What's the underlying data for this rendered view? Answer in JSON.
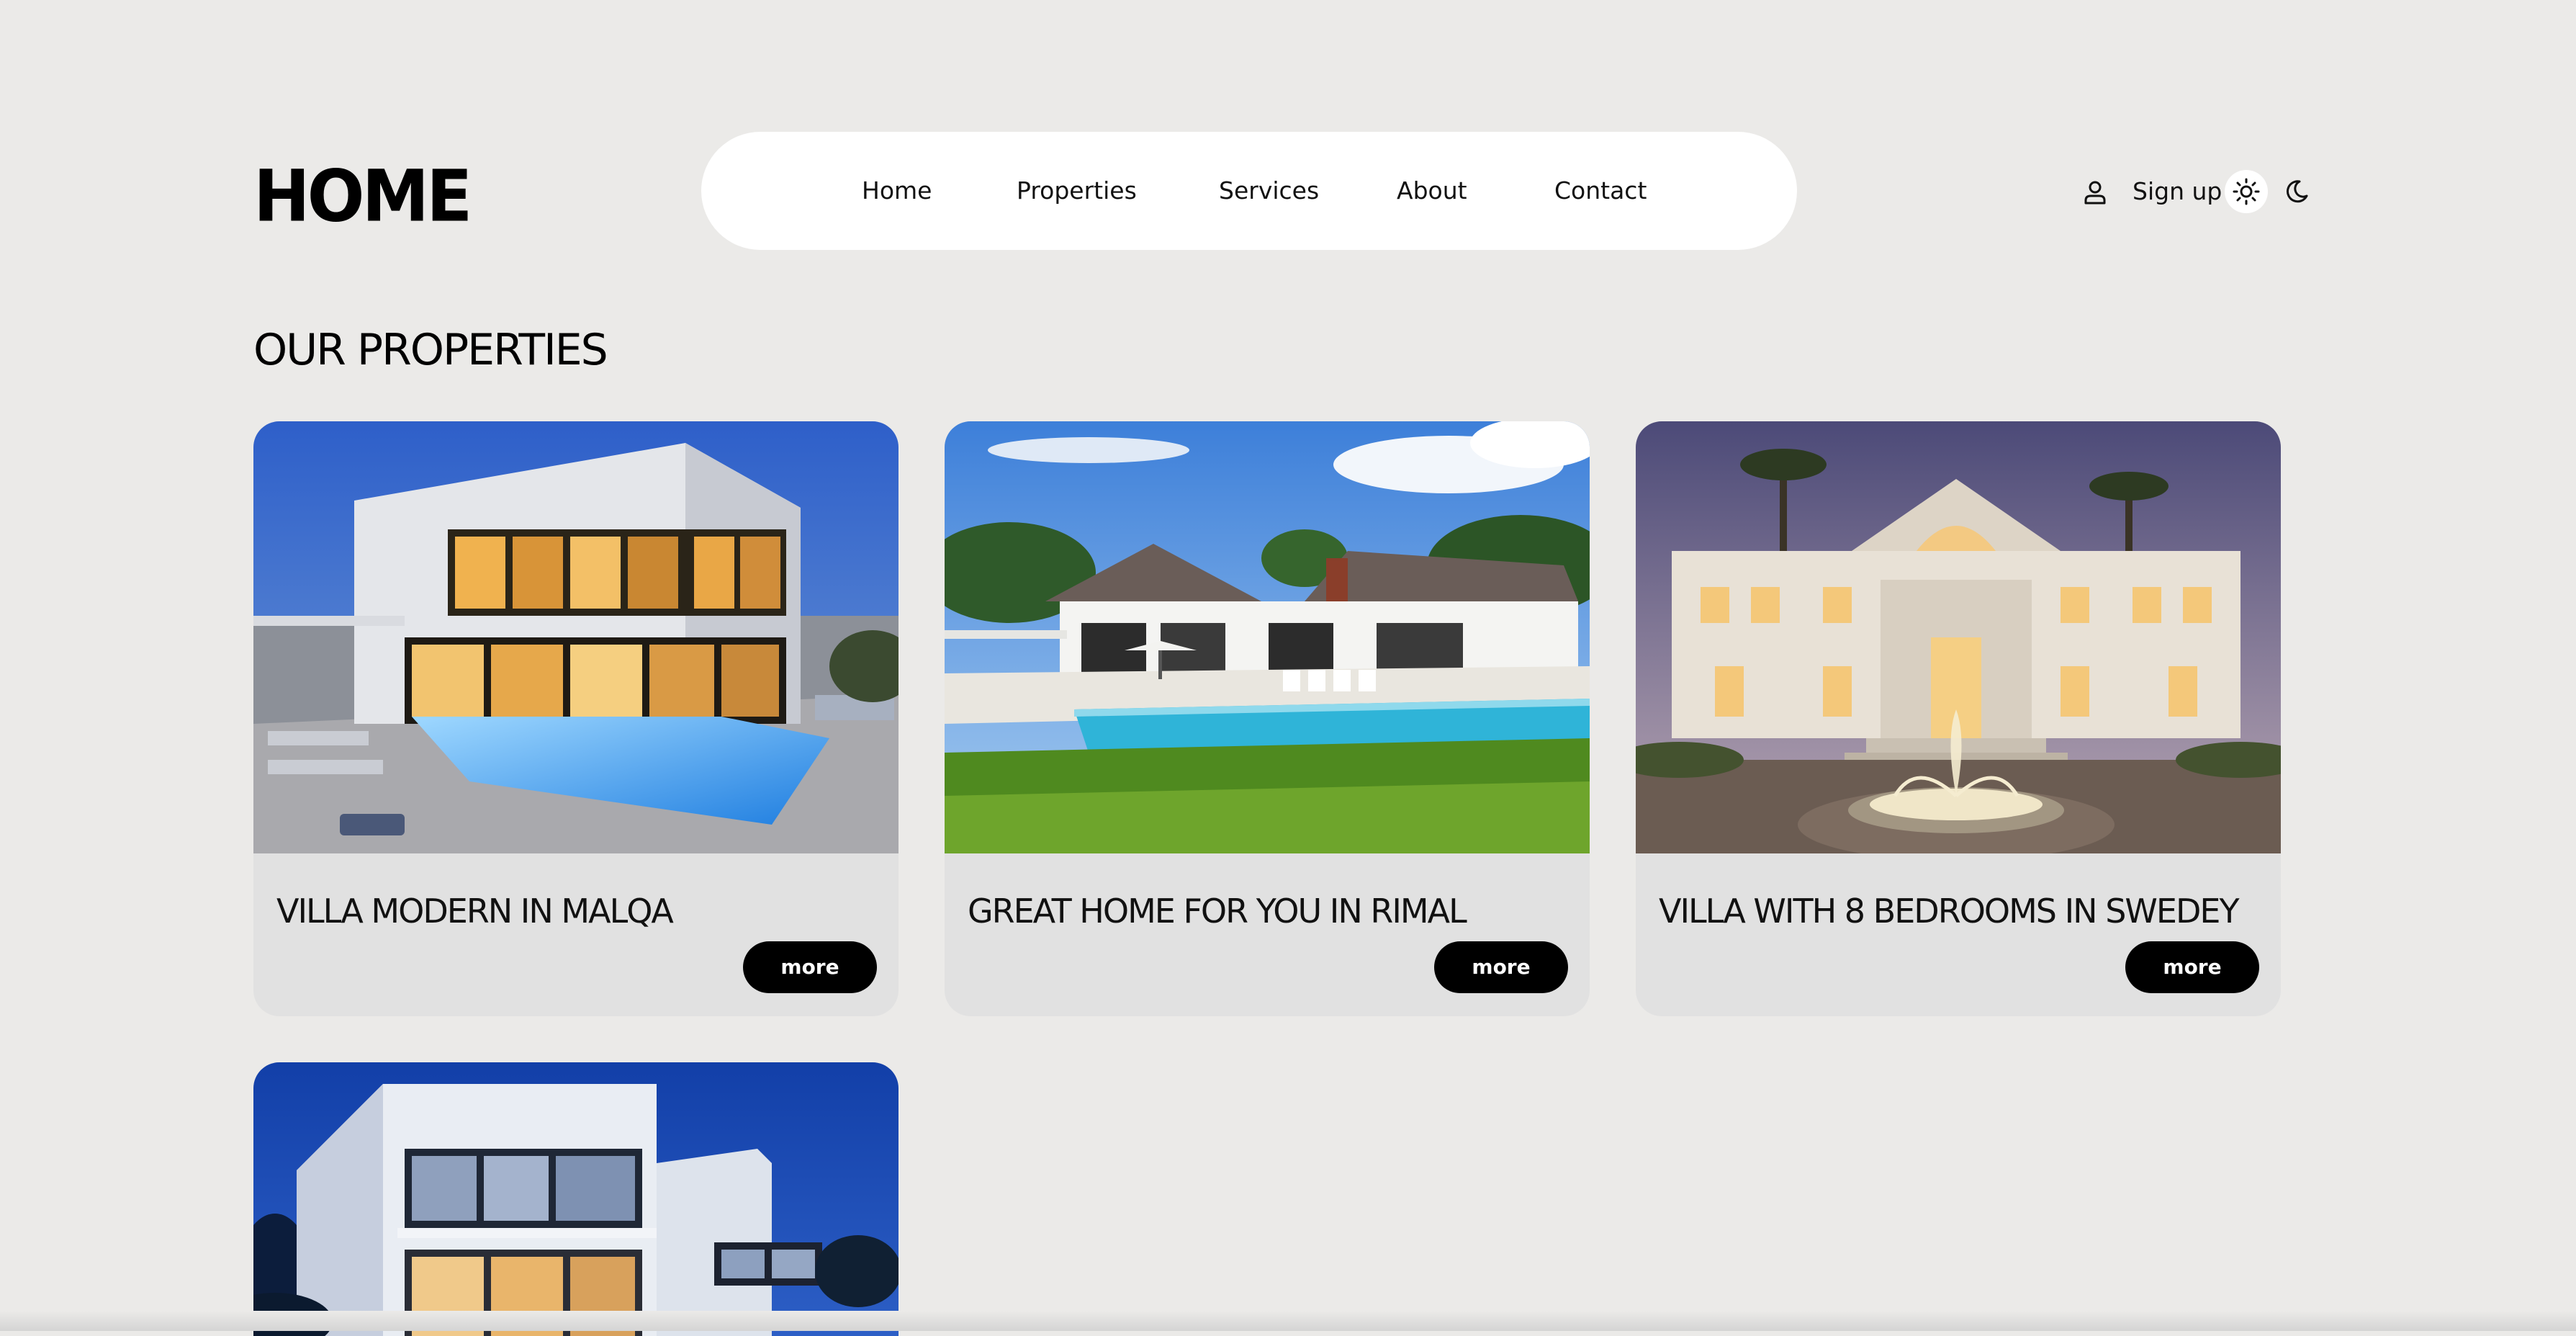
{
  "header": {
    "logo": "HOME",
    "nav": [
      {
        "label": "Home"
      },
      {
        "label": "Properties"
      },
      {
        "label": "Services"
      },
      {
        "label": "About"
      },
      {
        "label": "Contact"
      }
    ],
    "signup_label": "Sign up",
    "icons": {
      "user": "user-icon",
      "light_mode": "sun-icon",
      "dark_mode": "moon-icon"
    }
  },
  "main": {
    "section_title": "OUR PROPERTIES",
    "properties": [
      {
        "title": "VILLA MODERN IN MALQA",
        "more_label": "more"
      },
      {
        "title": "GREAT HOME FOR YOU IN RIMAL",
        "more_label": "more"
      },
      {
        "title": "VILLA WITH 8 BEDROOMS IN SWEDEY",
        "more_label": "more"
      },
      {
        "title": "",
        "more_label": ""
      }
    ]
  },
  "colors": {
    "background": "#ebeae8",
    "card_background": "#e1e1e1",
    "button": "#000000",
    "nav_background": "#ffffff"
  }
}
